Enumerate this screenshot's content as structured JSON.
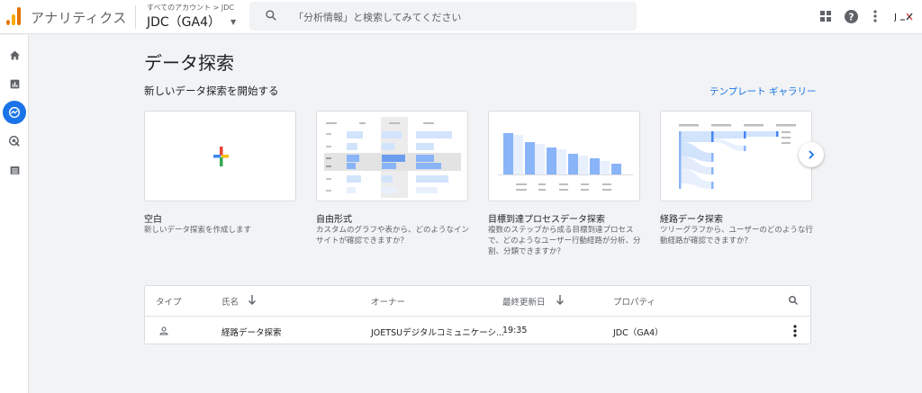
{
  "header": {
    "app_name": "アナリティクス",
    "account_path": "すべてのアカウント > JDC",
    "account_name": "JDC（GA4）",
    "search_placeholder": "「分析情報」と検索してみてください"
  },
  "page": {
    "title": "データ探索",
    "section_label": "新しいデータ探索を開始する",
    "gallery_link": "テンプレート ギャラリー"
  },
  "templates": [
    {
      "title": "空白",
      "desc": "新しいデータ探索を作成します"
    },
    {
      "title": "自由形式",
      "desc": "カスタムのグラフや表から、どのようなインサイトが確認できますか？"
    },
    {
      "title": "目標到達プロセスデータ探索",
      "desc": "複数のステップから成る目標到達プロセスで、どのようなユーザー行動経路が分析、分割、分類できますか？"
    },
    {
      "title": "経路データ探索",
      "desc": "ツリーグラフから、ユーザーのどのような行動経路が確認できますか？"
    }
  ],
  "table": {
    "headers": {
      "type": "タイプ",
      "name": "氏名",
      "owner": "オーナー",
      "modified": "最終更新日",
      "property": "プロパティ"
    },
    "rows": [
      {
        "name": "経路データ探索",
        "owner": "JOETSUデジタルコミュニケーシ...",
        "modified": "19:35",
        "property": "JDC（GA4）"
      }
    ]
  },
  "colors": {
    "accent": "#1a73e8",
    "chart_blue": "#8ab4f8",
    "chart_light": "#d2e3fc"
  }
}
